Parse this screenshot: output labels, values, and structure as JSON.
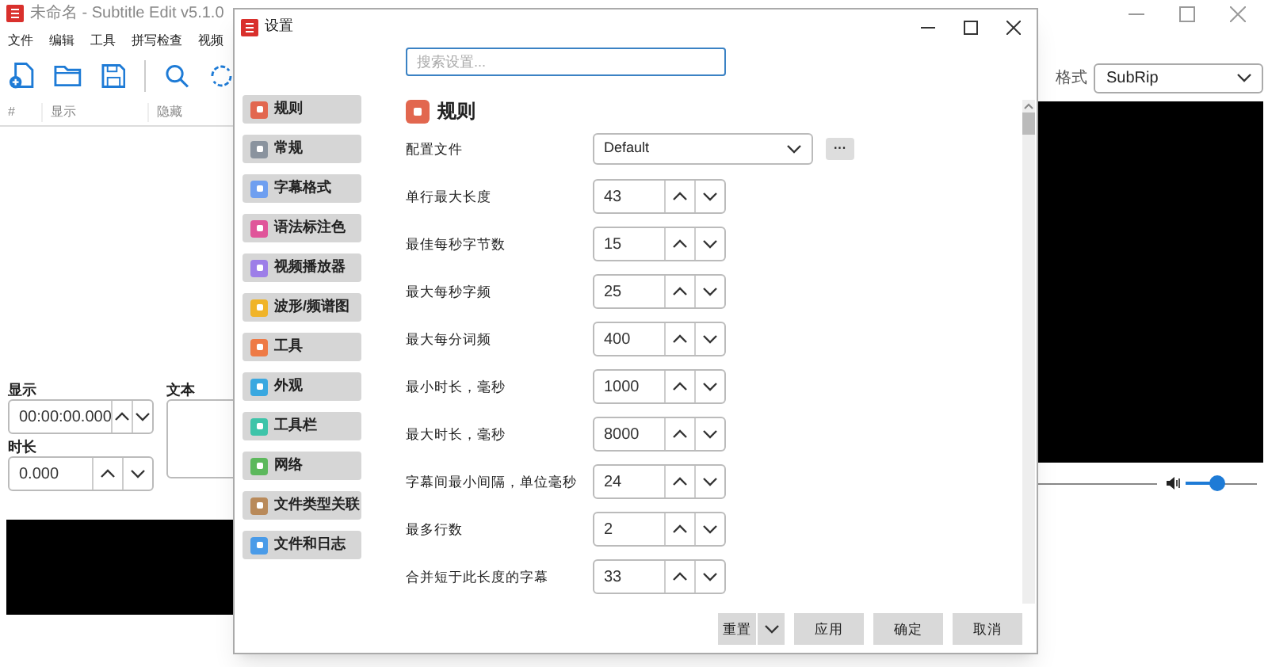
{
  "main_window": {
    "title": "未命名 - Subtitle Edit v5.1.0",
    "menu": [
      "文件",
      "编辑",
      "工具",
      "拼写检查",
      "视频"
    ],
    "columns": [
      "#",
      "显示",
      "隐藏"
    ],
    "show_label": "显示",
    "show_value": "00:00:00.000",
    "duration_label": "时长",
    "duration_value": "0.000",
    "text_label": "文本",
    "format_label": "格式",
    "format_value": "SubRip",
    "volume": {
      "level": 0.45
    }
  },
  "settings_dialog": {
    "title": "设置",
    "search": {
      "placeholder": "搜索设置..."
    },
    "sidebar": [
      {
        "label": "规则",
        "color": "#e2674f"
      },
      {
        "label": "常规",
        "color": "#8a939e"
      },
      {
        "label": "字幕格式",
        "color": "#6f9ff0"
      },
      {
        "label": "语法标注色",
        "color": "#e0559a"
      },
      {
        "label": "视频播放器",
        "color": "#9d7ee8"
      },
      {
        "label": "波形/频谱图",
        "color": "#f0b429"
      },
      {
        "label": "工具",
        "color": "#ee7a45"
      },
      {
        "label": "外观",
        "color": "#3aa8e0"
      },
      {
        "label": "工具栏",
        "color": "#3ec4a9"
      },
      {
        "label": "网络",
        "color": "#5cb85c"
      },
      {
        "label": "文件类型关联",
        "color": "#b98a5a"
      },
      {
        "label": "文件和日志",
        "color": "#4a9be8"
      }
    ],
    "section_title": "规则",
    "fields": [
      {
        "kind": "dropdown",
        "label": "配置文件",
        "value": "Default",
        "extra": "···"
      },
      {
        "kind": "spinner",
        "label": "单行最大长度",
        "value": "43"
      },
      {
        "kind": "spinner",
        "label": "最佳每秒字节数",
        "value": "15"
      },
      {
        "kind": "spinner",
        "label": "最大每秒字频",
        "value": "25"
      },
      {
        "kind": "spinner",
        "label": "最大每分词频",
        "value": "400"
      },
      {
        "kind": "spinner",
        "label": "最小时长，毫秒",
        "value": "1000"
      },
      {
        "kind": "spinner",
        "label": "最大时长，毫秒",
        "value": "8000"
      },
      {
        "kind": "spinner",
        "label": "字幕间最小间隔，单位毫秒",
        "value": "24"
      },
      {
        "kind": "spinner",
        "label": "最多行数",
        "value": "2"
      },
      {
        "kind": "spinner",
        "label": "合并短于此长度的字幕",
        "value": "33"
      }
    ],
    "reset": "重置",
    "buttons": [
      "应用",
      "确定",
      "取消"
    ]
  }
}
